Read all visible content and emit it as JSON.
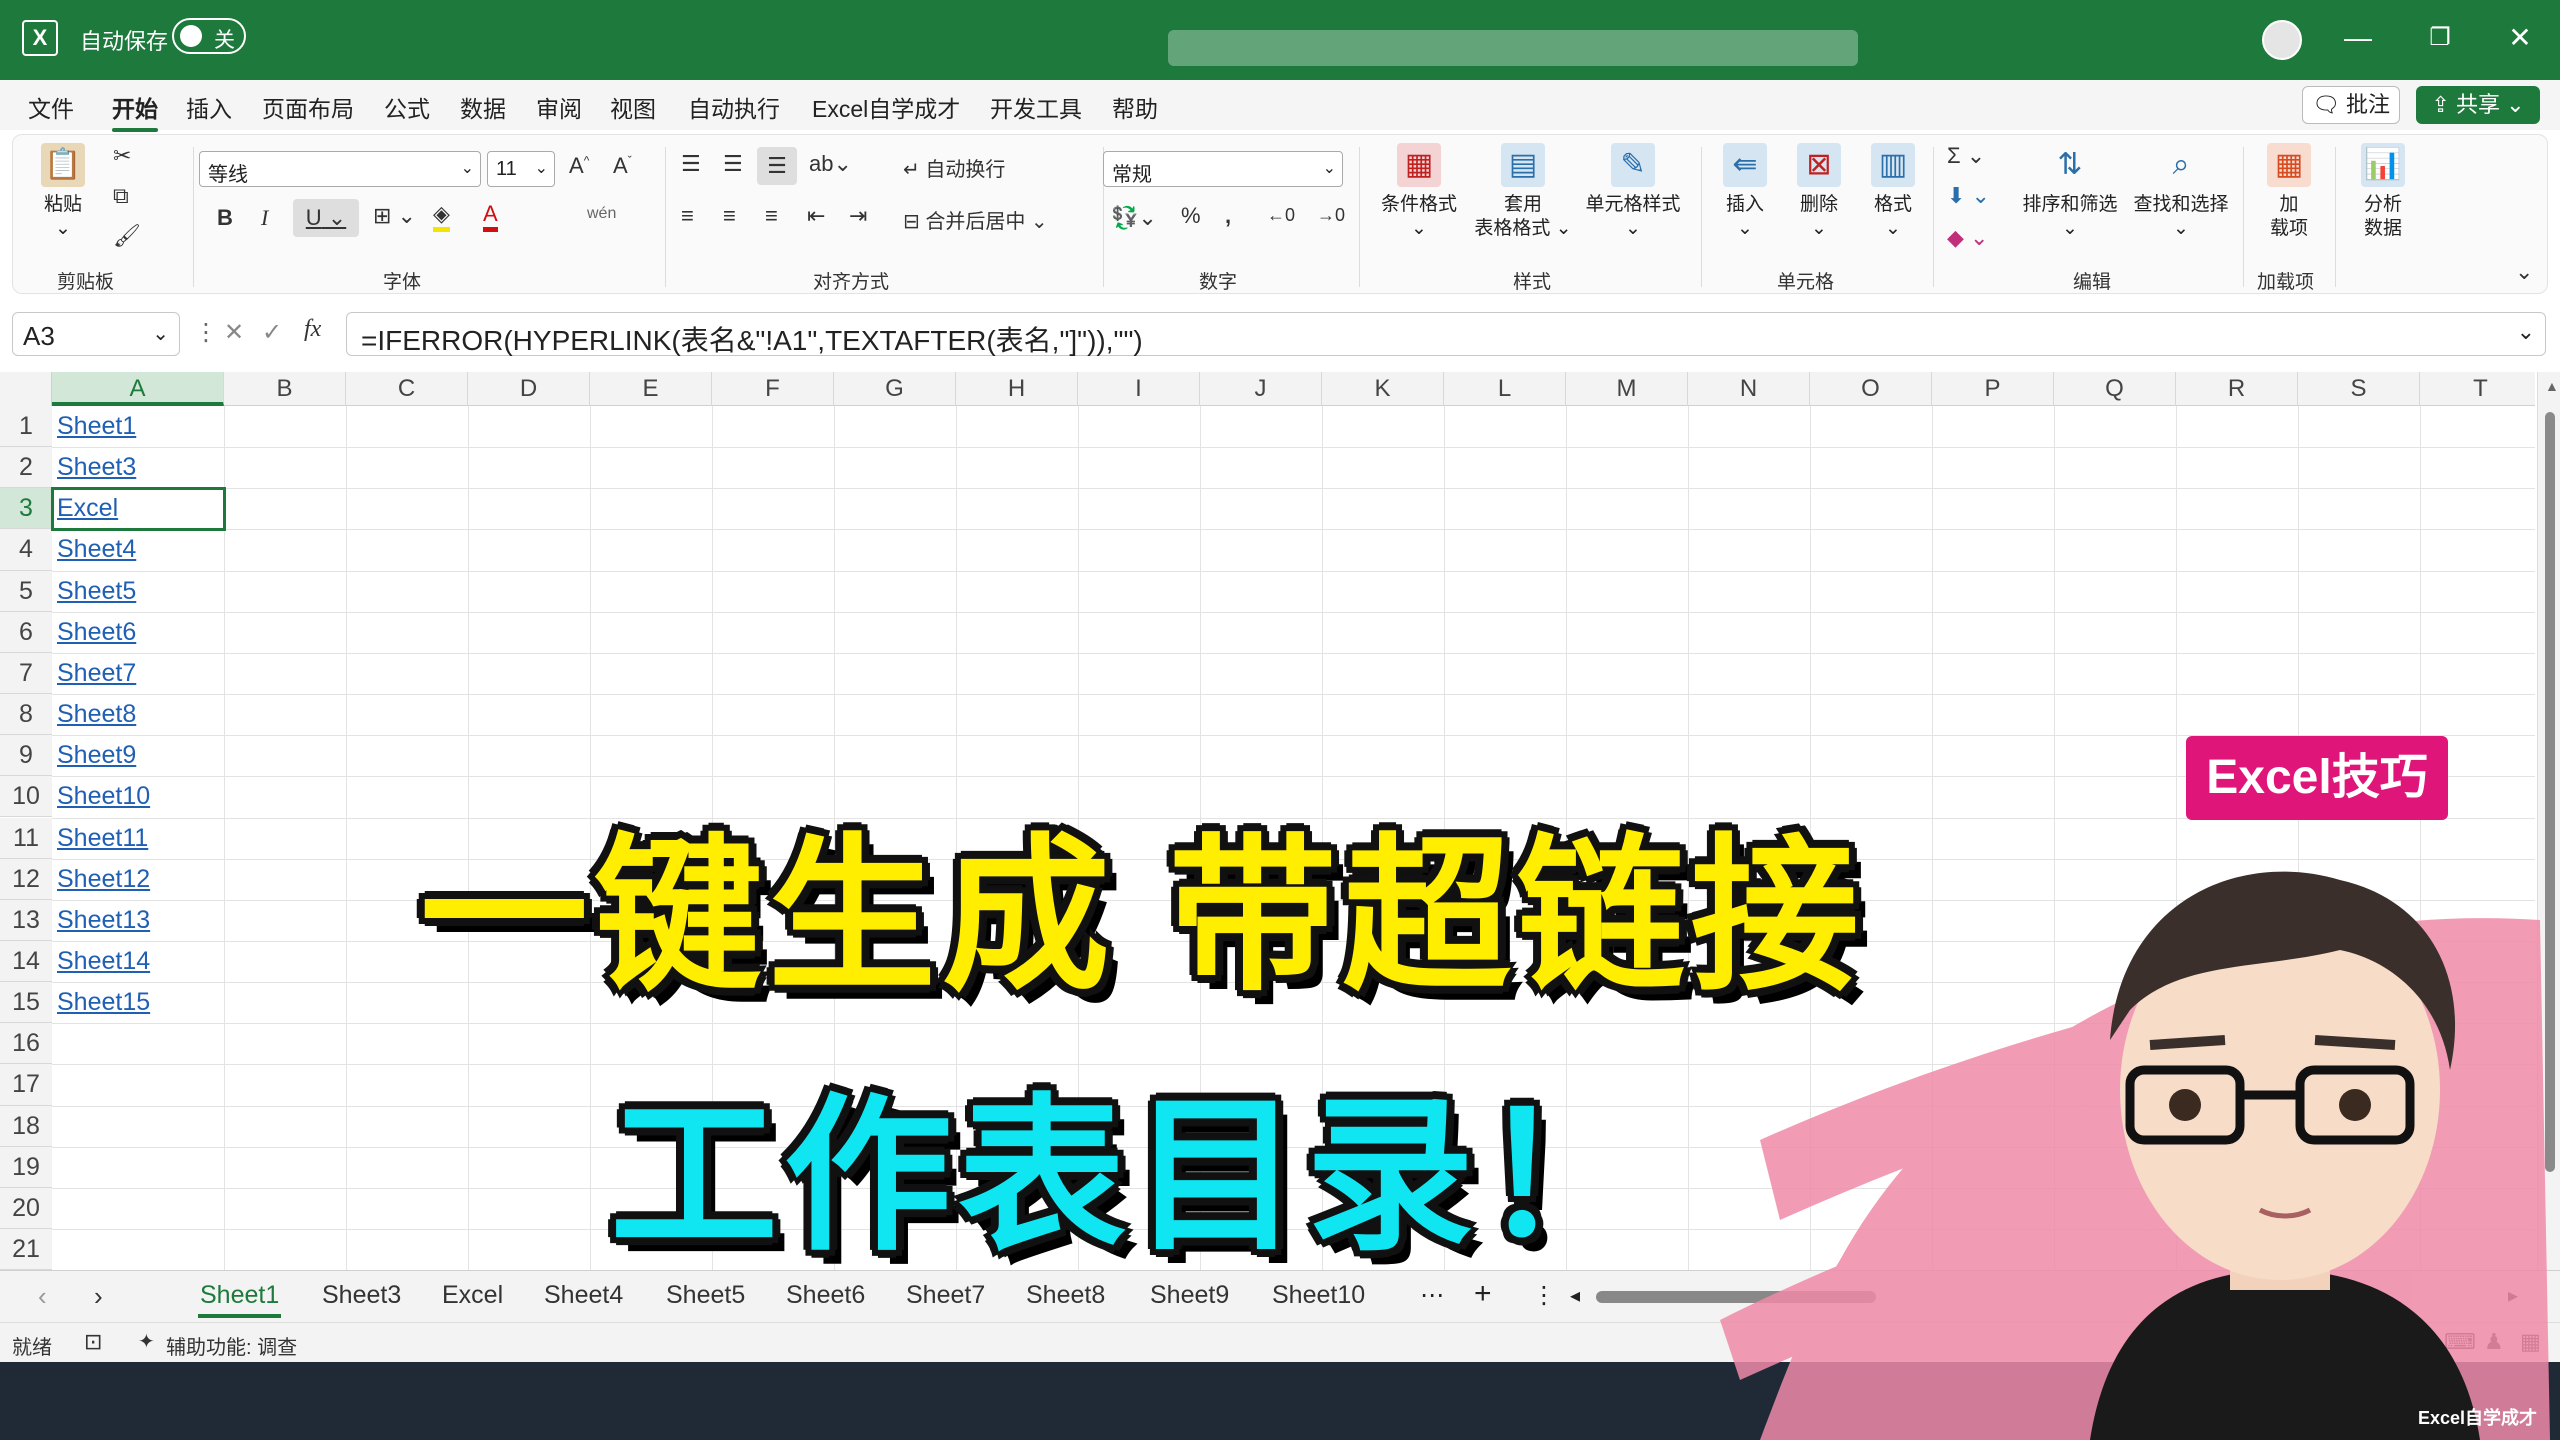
{
  "titlebar": {
    "autosave_label": "自动保存",
    "autosave_state": "关",
    "app_icon": "excel-icon"
  },
  "menu": [
    "文件",
    "开始",
    "插入",
    "页面布局",
    "公式",
    "数据",
    "审阅",
    "视图",
    "自动执行",
    "Excel自学成才",
    "开发工具",
    "帮助"
  ],
  "menu_active": "开始",
  "comment_label": "批注",
  "share_label": "共享",
  "ribbon": {
    "clipboard": {
      "paste": "粘贴",
      "group": "剪贴板"
    },
    "font": {
      "name": "等线",
      "size": "11",
      "group": "字体",
      "bold": "B",
      "italic": "I",
      "underline": "U"
    },
    "align": {
      "wrap": "自动换行",
      "merge": "合并后居中",
      "group": "对齐方式"
    },
    "number": {
      "format": "常规",
      "group": "数字"
    },
    "styles": {
      "cond": "条件格式",
      "table_l1": "套用",
      "table_l2": "表格格式",
      "cellstyle": "单元格样式",
      "group": "样式"
    },
    "cells": {
      "insert": "插入",
      "delete": "删除",
      "format": "格式",
      "group": "单元格"
    },
    "edit": {
      "sortfilter": "排序和筛选",
      "findselect": "查找和选择",
      "group": "编辑"
    },
    "addins": {
      "l1": "加",
      "l2": "载项",
      "group": "加载项"
    },
    "analyze": {
      "l1": "分析",
      "l2": "数据"
    }
  },
  "namebox": "A3",
  "formula": "=IFERROR(HYPERLINK(表名&\"!A1\",TEXTAFTER(表名,\"]\")),\"\")",
  "columns": [
    "A",
    "B",
    "C",
    "D",
    "E",
    "F",
    "G",
    "H",
    "I",
    "J",
    "K",
    "L",
    "M",
    "N",
    "O",
    "P",
    "Q",
    "R",
    "S",
    "T"
  ],
  "rows": [
    "1",
    "2",
    "3",
    "4",
    "5",
    "6",
    "7",
    "8",
    "9",
    "10",
    "11",
    "12",
    "13",
    "14",
    "15",
    "16",
    "17",
    "18",
    "19",
    "20",
    "21"
  ],
  "cells_a": [
    "Sheet1",
    "Sheet3",
    "Excel",
    "Sheet4",
    "Sheet5",
    "Sheet6",
    "Sheet7",
    "Sheet8",
    "Sheet9",
    "Sheet10",
    "Sheet11",
    "Sheet12",
    "Sheet13",
    "Sheet14",
    "Sheet15"
  ],
  "sheet_tabs": [
    "Sheet1",
    "Sheet3",
    "Excel",
    "Sheet4",
    "Sheet5",
    "Sheet6",
    "Sheet7",
    "Sheet8",
    "Sheet9",
    "Sheet10"
  ],
  "status": {
    "ready": "就绪",
    "accessibility": "辅助功能: 调查"
  },
  "overlay": {
    "line1": "一键生成 带超链接",
    "line2": "工作表目录！",
    "badge": "Excel技巧",
    "watermark": "Excel自学成才"
  },
  "colors": {
    "brand": "#1e7a3c",
    "link": "#1f5fb4",
    "yellow": "#ffee00",
    "cyan": "#10e6f2",
    "badge": "#e0157a"
  }
}
